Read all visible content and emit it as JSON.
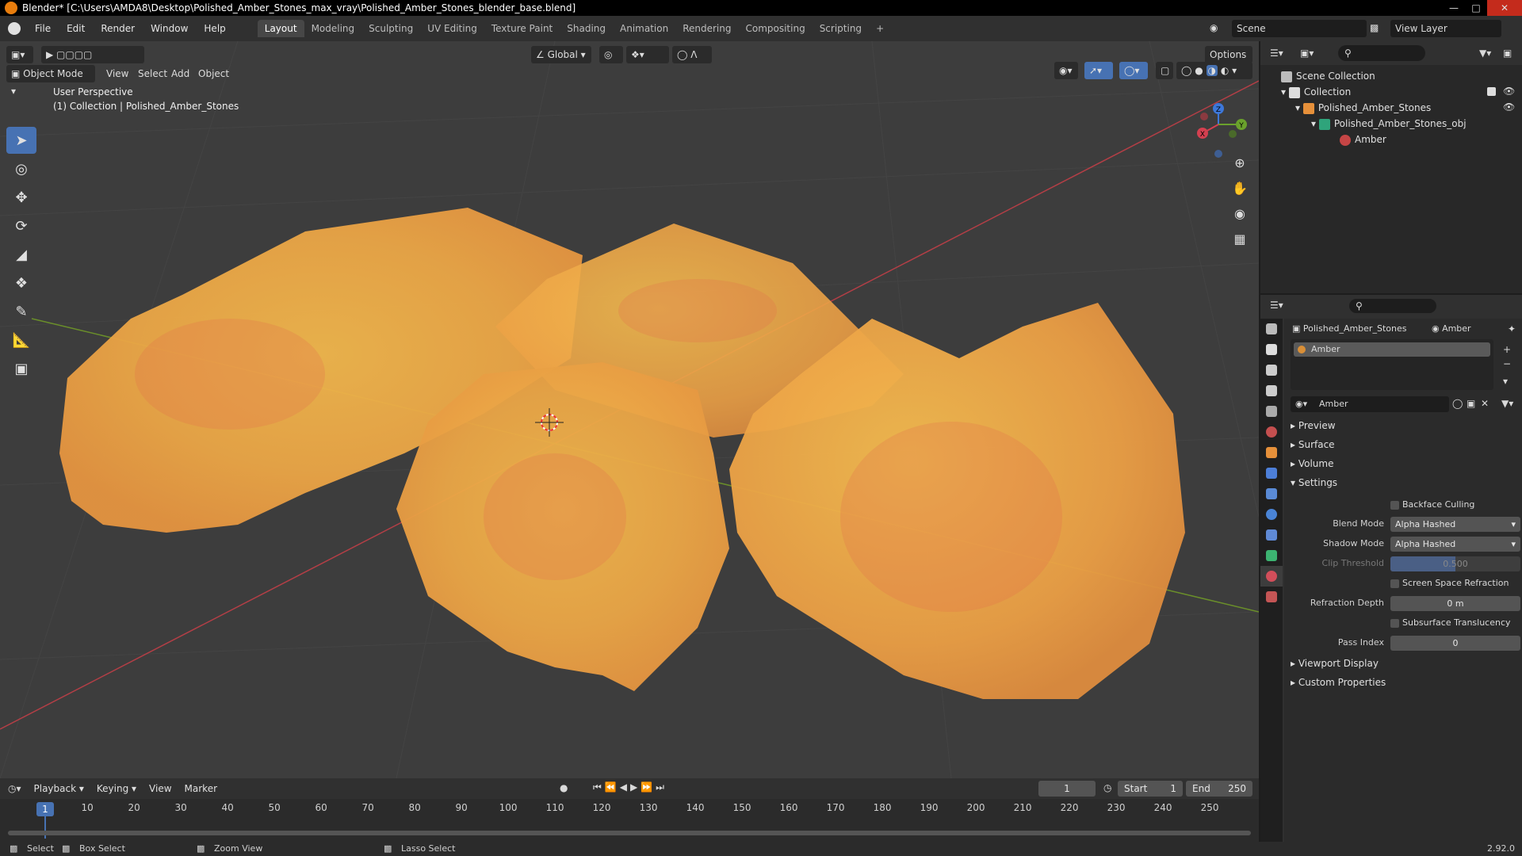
{
  "window": {
    "title": "Blender* [C:\\Users\\AMDA8\\Desktop\\Polished_Amber_Stones_max_vray\\Polished_Amber_Stones_blender_base.blend]"
  },
  "menu": {
    "file": "File",
    "edit": "Edit",
    "render": "Render",
    "window": "Window",
    "help": "Help"
  },
  "workspaces": [
    "Layout",
    "Modeling",
    "Sculpting",
    "UV Editing",
    "Texture Paint",
    "Shading",
    "Animation",
    "Rendering",
    "Compositing",
    "Scripting"
  ],
  "active_workspace": "Layout",
  "scene": {
    "name": "Scene",
    "view_layer": "View Layer"
  },
  "viewport": {
    "mode": "Object Mode",
    "menus": [
      "View",
      "Select",
      "Add",
      "Object"
    ],
    "orientation": "Global",
    "options": "Options",
    "info_line1": "User Perspective",
    "info_line2": "(1) Collection | Polished_Amber_Stones",
    "gizmo": {
      "x": "X",
      "y": "Y",
      "z": "Z"
    },
    "colors": {
      "grid_x": "#b33e46",
      "grid_y": "#6a8e2a",
      "amber_a": "#f2b545",
      "amber_b": "#e89a3c",
      "background": "#3d3d3d"
    }
  },
  "outliner": {
    "scene_collection": "Scene Collection",
    "collection": "Collection",
    "object": "Polished_Amber_Stones",
    "mesh": "Polished_Amber_Stones_obj",
    "material": "Amber"
  },
  "properties": {
    "breadcrumb_object": "Polished_Amber_Stones",
    "breadcrumb_material": "Amber",
    "slot_name": "Amber",
    "material_name": "Amber",
    "sections": {
      "preview": "Preview",
      "surface": "Surface",
      "volume": "Volume",
      "settings": "Settings",
      "viewport_display": "Viewport Display",
      "custom_properties": "Custom Properties"
    },
    "backface_culling": "Backface Culling",
    "blend_mode_label": "Blend Mode",
    "blend_mode": "Alpha Hashed",
    "shadow_mode_label": "Shadow Mode",
    "shadow_mode": "Alpha Hashed",
    "clip_threshold_label": "Clip Threshold",
    "clip_threshold": "0.500",
    "ssr_label": "Screen Space Refraction",
    "refraction_depth_label": "Refraction Depth",
    "refraction_depth": "0 m",
    "sss_label": "Subsurface Translucency",
    "pass_index_label": "Pass Index",
    "pass_index": "0"
  },
  "timeline": {
    "menus": [
      "Playback",
      "Keying",
      "View",
      "Marker"
    ],
    "current_frame": "1",
    "start_label": "Start",
    "start": "1",
    "end_label": "End",
    "end": "250",
    "ticks": [
      "10",
      "20",
      "30",
      "40",
      "50",
      "60",
      "70",
      "80",
      "90",
      "100",
      "110",
      "120",
      "130",
      "140",
      "150",
      "160",
      "170",
      "180",
      "190",
      "200",
      "210",
      "220",
      "230",
      "240",
      "250"
    ],
    "playhead": "1"
  },
  "status": {
    "select": "Select",
    "box_select": "Box Select",
    "zoom_view": "Zoom View",
    "lasso_select": "Lasso Select",
    "version": "2.92.0"
  }
}
